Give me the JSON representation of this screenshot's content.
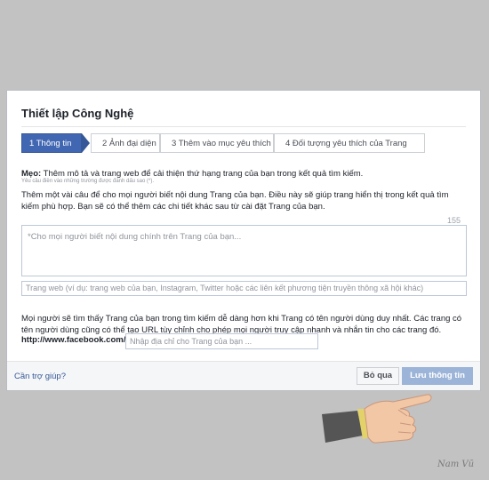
{
  "dialog": {
    "title": "Thiết lập Công Nghệ",
    "steps": [
      {
        "label": "1 Thông tin",
        "active": true
      },
      {
        "label": "2 Ảnh đại diện",
        "active": false
      },
      {
        "label": "3 Thêm vào mục yêu thích",
        "active": false
      },
      {
        "label": "4 Đối tượng yêu thích của Trang",
        "active": false
      }
    ],
    "tip_label": "Mẹo:",
    "tip_text": " Thêm mô tả và trang web để cải thiện thứ hạng trang của bạn trong kết quả tìm kiếm.",
    "tip_sub": "Yêu cầu điền vào những trường được đánh dấu sao (*).",
    "description": "Thêm một vài câu để cho mọi người biết nội dung Trang của bạn. Điều này sẽ giúp trang hiển thị trong kết quả tìm kiếm phù hợp. Bạn sẽ có thể thêm các chi tiết khác sau từ cài đặt Trang của bạn.",
    "char_counter": "155",
    "about_placeholder": "*Cho mọi người biết nội dung chính trên Trang của bạn...",
    "website_placeholder": "Trang web (ví dụ: trang web của bạn, Instagram, Twitter hoặc các liên kết phương tiện truyền thông xã hội khác)",
    "url_info": "Mọi người sẽ tìm thấy Trang của bạn trong tìm kiếm dễ dàng hơn khi Trang có tên người dùng duy nhất. Các trang có tên người dùng cũng có thể tạo URL tùy chỉnh cho phép mọi người truy cập nhanh và nhắn tin cho các trang đó.",
    "url_prefix": "http://www.facebook.com/",
    "url_placeholder": "Nhập địa chỉ cho Trang của bạn ...",
    "help_link": "Cần trợ giúp?",
    "skip_button": "Bỏ qua",
    "save_button": "Lưu thông tin"
  },
  "signature": "Nam Vũ",
  "colors": {
    "primary": "#4267b2",
    "save_disabled": "#9cb4d8",
    "link": "#365899",
    "background": "#c2c2c2"
  }
}
